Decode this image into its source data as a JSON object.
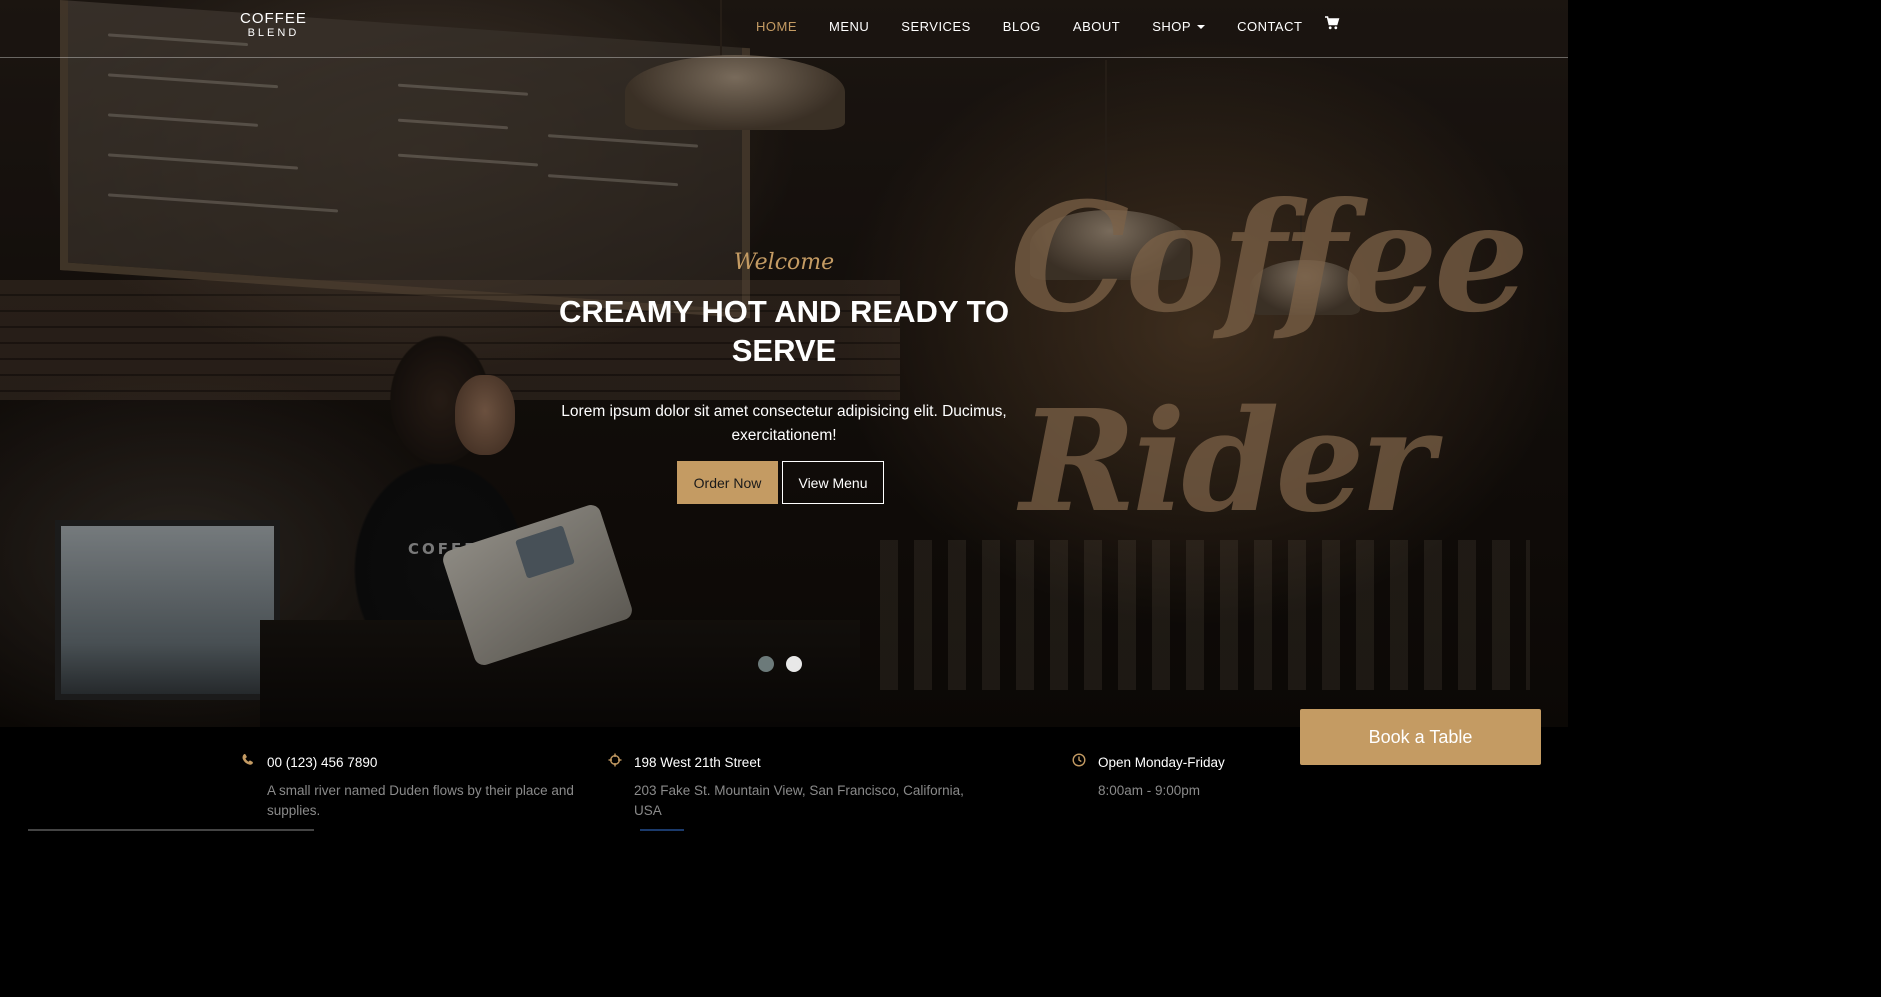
{
  "brand": {
    "line1": "COFFEE",
    "line2": "BLEND"
  },
  "nav": {
    "items": [
      {
        "label": "HOME",
        "active": true
      },
      {
        "label": "MENU"
      },
      {
        "label": "SERVICES"
      },
      {
        "label": "BLOG"
      },
      {
        "label": "ABOUT"
      },
      {
        "label": "SHOP",
        "dropdown": true
      },
      {
        "label": "CONTACT"
      }
    ],
    "cart_icon": "shopping-cart-icon"
  },
  "hero": {
    "welcome": "Welcome",
    "title": "CREAMY HOT AND READY TO SERVE",
    "subtitle": "Lorem ipsum dolor sit amet consectetur adipisicing elit. Ducimus, exercitationem!",
    "order_button": "Order Now",
    "view_button": "View Menu",
    "slides": 2,
    "active_slide": 2
  },
  "info": {
    "phone": {
      "icon": "phone-icon",
      "title": "00 (123) 456 7890",
      "text": "A small river named Duden flows by their place and supplies."
    },
    "address": {
      "icon": "location-crosshair-icon",
      "title": "198 West 21th Street",
      "text": "203 Fake St. Mountain View, San Francisco, California, USA"
    },
    "hours": {
      "icon": "clock-icon",
      "title": "Open Monday-Friday",
      "text": "8:00am - 9:00pm"
    }
  },
  "book_button": "Book a Table",
  "colors": {
    "accent": "#c49b63",
    "infobar_bg": "#000000"
  }
}
